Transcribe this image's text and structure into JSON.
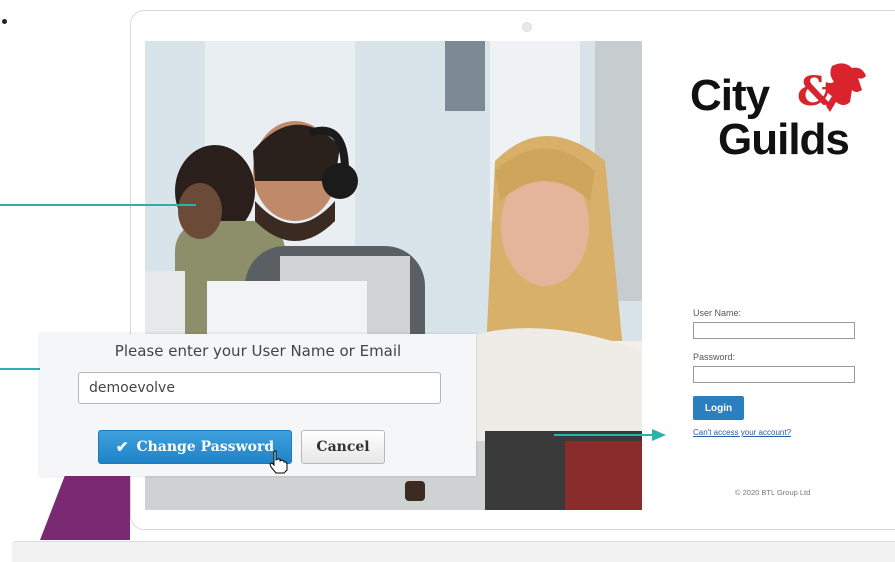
{
  "colors": {
    "accent_teal": "#2bb1ac",
    "login_blue": "#2a7fc1",
    "brand_red": "#d9232d",
    "purple": "#7a2a73"
  },
  "dialog": {
    "prompt": "Please enter your User Name or Email",
    "username_value": "demoevolve",
    "change_password_label": "Change Password",
    "cancel_label": "Cancel",
    "check_icon": "check-icon",
    "cursor_icon": "hand-pointer-icon"
  },
  "logo": {
    "line1": "City",
    "line2": "Guilds",
    "ampersand": "&"
  },
  "login": {
    "username_label": "User Name:",
    "password_label": "Password:",
    "login_button": "Login",
    "cant_access_link": "Can't access your account?",
    "copyright": "© 2020 BTL Group Ltd"
  }
}
